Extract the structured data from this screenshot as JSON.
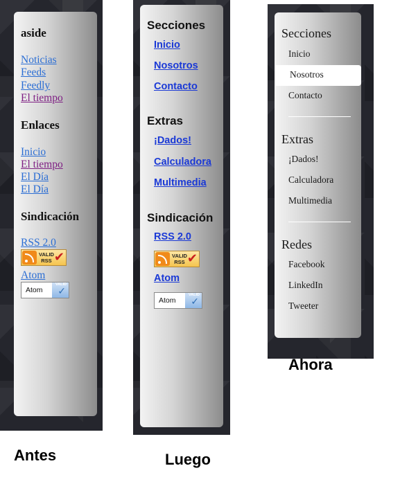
{
  "antes": {
    "caption": "Antes",
    "h_aside": "aside",
    "links1": [
      "Noticias",
      "Feeds",
      "Feedly",
      "El tiempo"
    ],
    "h_enlaces": "Enlaces",
    "links2": [
      "Inicio",
      "El tiempo",
      "El Día",
      "El Día"
    ],
    "h_sindicacion": "Sindicación",
    "rss_link": "RSS 2.0",
    "rss_badge_text": "VALID\nRSS",
    "atom_link": "Atom",
    "atom_badge_text": "Atom",
    "atom_valid_text": "VALID"
  },
  "luego": {
    "caption": "Luego",
    "h_secciones": "Secciones",
    "links1": [
      "Inicio",
      "Nosotros",
      "Contacto"
    ],
    "h_extras": "Extras",
    "links2": [
      "¡Dados!",
      "Calculadora",
      "Multimedia"
    ],
    "h_sindicacion": "Sindicación",
    "rss_link": "RSS 2.0",
    "rss_badge_text": "VALID\nRSS",
    "atom_link": "Atom",
    "atom_badge_text": "Atom",
    "atom_valid_text": "VALID"
  },
  "ahora": {
    "caption": "Ahora",
    "h_secciones": "Secciones",
    "items1": [
      "Inicio",
      "Nosotros",
      "Contacto"
    ],
    "selected": "Nosotros",
    "h_extras": "Extras",
    "items2": [
      "¡Dados!",
      "Calculadora",
      "Multimedia"
    ],
    "h_redes": "Redes",
    "items3": [
      "Facebook",
      "LinkedIn",
      "Tweeter"
    ]
  },
  "icons": [
    "rss-icon",
    "checkmark-icon"
  ],
  "colors": {
    "frame": "#25262d",
    "link_blue": "#2a6dd4",
    "link_visited": "#7e1f83",
    "link_bold_blue": "#1a39d6",
    "selected_bg": "#ffffff"
  }
}
